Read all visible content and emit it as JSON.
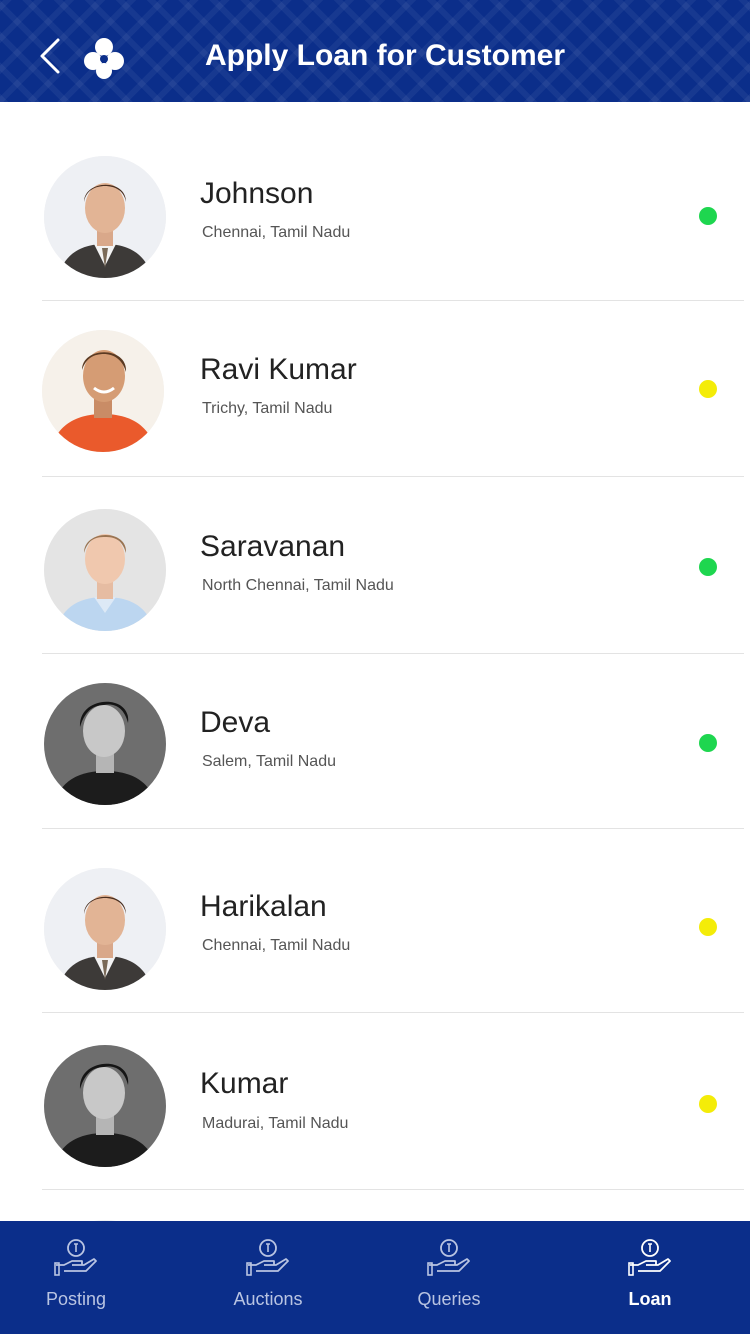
{
  "header": {
    "title": "Apply Loan for Customer"
  },
  "customers": [
    {
      "name": "Johnson",
      "location": "Chennai, Tamil Nadu",
      "status_color": "#1ed64f",
      "avatar": "man-suit"
    },
    {
      "name": "Ravi Kumar",
      "location": "Trichy, Tamil Nadu",
      "status_color": "#f4ec08",
      "avatar": "man-orange-shirt"
    },
    {
      "name": "Saravanan",
      "location": "North Chennai, Tamil Nadu",
      "status_color": "#1ed64f",
      "avatar": "man-blue-shirt"
    },
    {
      "name": "Deva",
      "location": "Salem, Tamil Nadu",
      "status_color": "#1ed64f",
      "avatar": "man-bw"
    },
    {
      "name": "Harikalan",
      "location": "Chennai, Tamil Nadu",
      "status_color": "#f4ec08",
      "avatar": "man-suit"
    },
    {
      "name": "Kumar",
      "location": "Madurai, Tamil Nadu",
      "status_color": "#f4ec08",
      "avatar": "man-bw"
    }
  ],
  "bottom_nav": [
    {
      "label": "Posting",
      "icon": "hand-coin-icon",
      "active": false
    },
    {
      "label": "Auctions",
      "icon": "hand-coin-icon",
      "active": false
    },
    {
      "label": "Queries",
      "icon": "hand-coin-icon",
      "active": false
    },
    {
      "label": "Loan",
      "icon": "hand-coin-icon",
      "active": true
    }
  ],
  "colors": {
    "brand_blue": "#0b2e8a",
    "online_green": "#1ed64f",
    "pending_yellow": "#f4ec08"
  }
}
